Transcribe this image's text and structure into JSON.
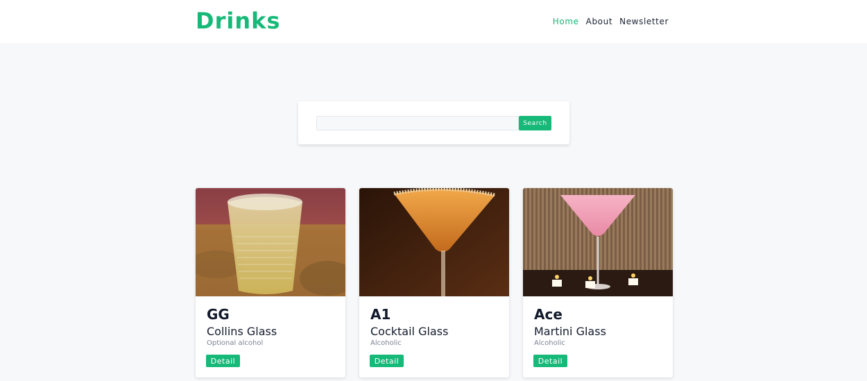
{
  "brand": {
    "name": "Drinks",
    "color": "#17b978"
  },
  "nav": {
    "items": [
      "Home",
      "About",
      "Newsletter"
    ],
    "active": "Home"
  },
  "search": {
    "value": "",
    "button_label": "Search"
  },
  "cards": [
    {
      "name": "GG",
      "glass": "Collins Glass",
      "alcohol": "Optional alcohol",
      "button_label": "Detail",
      "image": "whiskey-tumbler-drink"
    },
    {
      "name": "A1",
      "glass": "Cocktail Glass",
      "alcohol": "Alcoholic",
      "button_label": "Detail",
      "image": "orange-cocktail-sugar-rim"
    },
    {
      "name": "Ace",
      "glass": "Martini Glass",
      "alcohol": "Alcoholic",
      "button_label": "Detail",
      "image": "pink-martini-candles"
    }
  ]
}
